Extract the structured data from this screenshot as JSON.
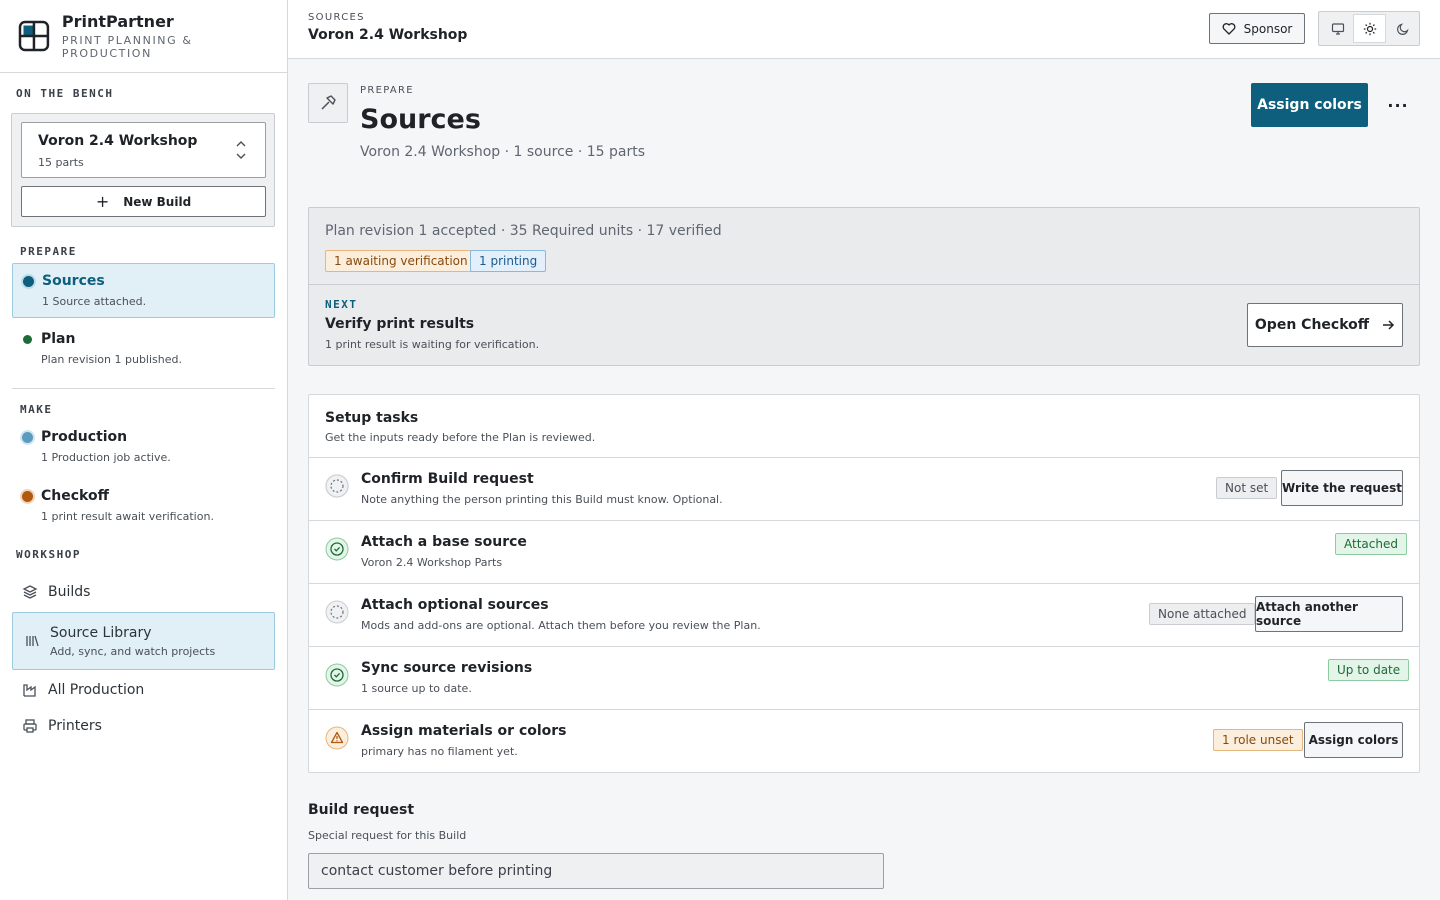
{
  "brand": {
    "name": "PrintPartner",
    "tagline": "PRINT PLANNING & PRODUCTION"
  },
  "sidebar": {
    "bench_label": "ON THE BENCH",
    "current_build": {
      "name": "Voron 2.4 Workshop",
      "parts": "15 parts"
    },
    "new_build_label": "New Build",
    "prepare_label": "PREPARE",
    "make_label": "MAKE",
    "workshop_label": "WORKSHOP",
    "steps": [
      {
        "label": "Sources",
        "sub": "1 Source attached.",
        "dot_color": "#0e5e7d"
      },
      {
        "label": "Plan",
        "sub": "Plan revision 1 published.",
        "dot_color": "#1d6b36"
      },
      {
        "label": "Production",
        "sub": "1 Production job active.",
        "dot_color": "#5a9bbf"
      },
      {
        "label": "Checkoff",
        "sub": "1 print result await verification.",
        "dot_color": "#b05a10"
      }
    ],
    "workshop": {
      "builds": "Builds",
      "source_library": {
        "label": "Source Library",
        "sub": "Add, sync, and watch projects"
      },
      "all_production": "All Production",
      "printers": "Printers"
    }
  },
  "topbar": {
    "crumb_section": "SOURCES",
    "crumb_build": "Voron 2.4 Workshop",
    "sponsor_label": "Sponsor"
  },
  "header": {
    "eyebrow": "PREPARE",
    "title": "Sources",
    "subtitle": "Voron 2.4 Workshop · 1 source · 15 parts",
    "primary_action": "Assign colors",
    "more": "···"
  },
  "status": {
    "summary": "Plan revision 1 accepted · 35 Required units · 17 verified",
    "badge_awaiting": "1 awaiting verification",
    "badge_printing": "1 printing",
    "next_label": "NEXT",
    "next_title": "Verify print results",
    "next_sub": "1 print result is waiting for verification.",
    "next_action": "Open Checkoff"
  },
  "tasks": {
    "title": "Setup tasks",
    "subtitle": "Get the inputs ready before the Plan is reviewed.",
    "items": [
      {
        "title": "Confirm Build request",
        "sub": "Note anything the person printing this Build must know. Optional.",
        "badge": "Not set",
        "action": "Write the request",
        "state": "pending"
      },
      {
        "title": "Attach a base source",
        "sub": "Voron 2.4 Workshop Parts",
        "badge": "Attached",
        "action": "",
        "state": "done"
      },
      {
        "title": "Attach optional sources",
        "sub": "Mods and add-ons are optional. Attach them before you review the Plan.",
        "badge": "None attached",
        "action": "Attach another source",
        "state": "pending"
      },
      {
        "title": "Sync source revisions",
        "sub": "1 source up to date.",
        "badge": "Up to date",
        "action": "",
        "state": "done"
      },
      {
        "title": "Assign materials or colors",
        "sub": "primary has no filament yet.",
        "badge": "1 role unset",
        "action": "Assign colors",
        "state": "warning"
      }
    ]
  },
  "build_request": {
    "title": "Build request",
    "label": "Special request for this Build",
    "value": "contact customer before printing"
  },
  "colors": {
    "accent": "#0e5e7d",
    "success": "#1d6b36",
    "warning": "#b05a10"
  }
}
